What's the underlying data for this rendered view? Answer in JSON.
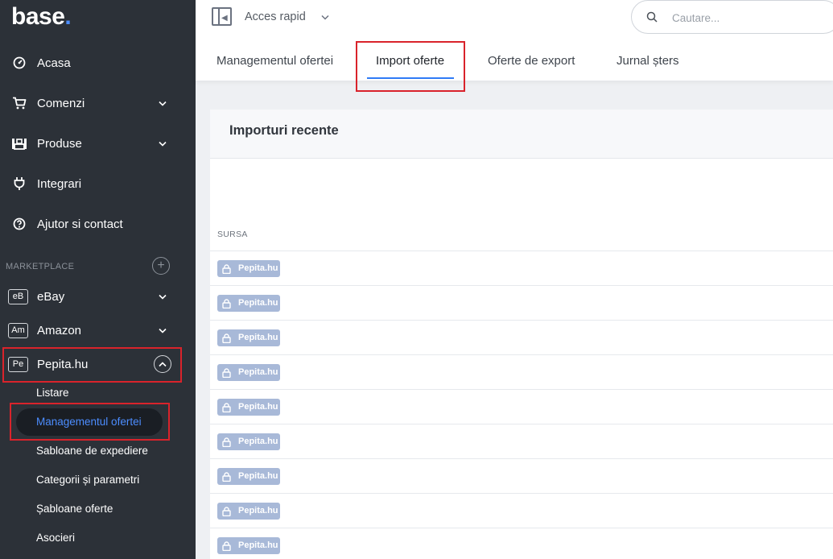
{
  "brand": {
    "logo_text": "base",
    "logo_dot": ".",
    "accent_color": "#4c8dff"
  },
  "sidebar": {
    "items": [
      {
        "label": "Acasa",
        "icon": "dashboard-gauge-icon"
      },
      {
        "label": "Comenzi",
        "icon": "cart-icon"
      },
      {
        "label": "Produse",
        "icon": "products-icon"
      },
      {
        "label": "Integrari",
        "icon": "plug-icon"
      },
      {
        "label": "Ajutor si contact",
        "icon": "help-icon"
      }
    ],
    "section_label": "MARKETPLACE",
    "marketplaces": [
      {
        "badge": "eB",
        "label": "eBay"
      },
      {
        "badge": "Am",
        "label": "Amazon"
      },
      {
        "badge": "Pe",
        "label": "Pepita.hu"
      }
    ],
    "submenu": [
      {
        "label": "Listare"
      },
      {
        "label": "Managementul ofertei",
        "active": true
      },
      {
        "label": "Sabloane de expediere"
      },
      {
        "label": "Categorii și parametri"
      },
      {
        "label": "Șabloane oferte"
      },
      {
        "label": "Asocieri"
      }
    ]
  },
  "header": {
    "quick_access_label": "Acces rapid",
    "search": {
      "placeholder": "Cautare...",
      "value": ""
    },
    "tabs": [
      {
        "label": "Managementul ofertei"
      },
      {
        "label": "Import oferte",
        "active": true
      },
      {
        "label": "Oferte de export"
      },
      {
        "label": "Jurnal șters"
      }
    ]
  },
  "main": {
    "card_title": "Importuri recente",
    "column_header": "SURSA",
    "rows": [
      {
        "source": "Pepita.hu"
      },
      {
        "source": "Pepita.hu"
      },
      {
        "source": "Pepita.hu"
      },
      {
        "source": "Pepita.hu"
      },
      {
        "source": "Pepita.hu"
      },
      {
        "source": "Pepita.hu"
      },
      {
        "source": "Pepita.hu"
      },
      {
        "source": "Pepita.hu"
      },
      {
        "source": "Pepita.hu"
      }
    ]
  }
}
